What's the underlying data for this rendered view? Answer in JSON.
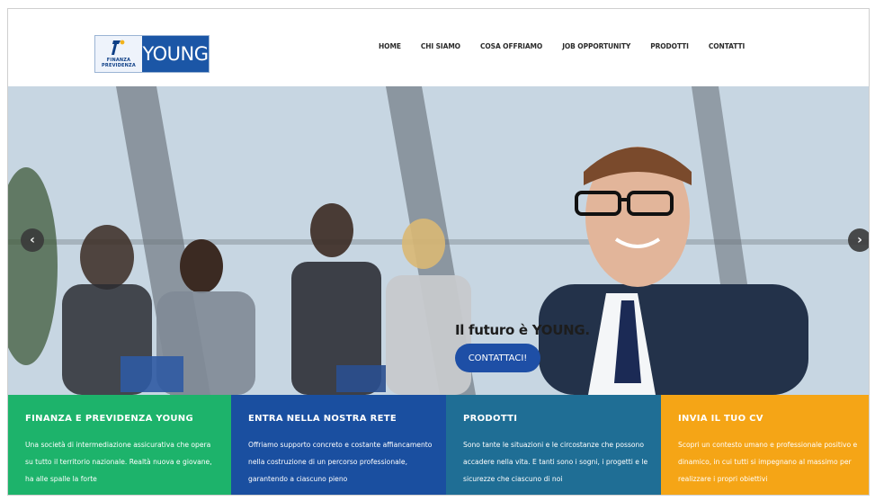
{
  "header": {
    "logo": {
      "left_line1": "FINANZA",
      "left_line2": "PREVIDENZA",
      "right_text": "YOUNG"
    },
    "nav": [
      {
        "label": "HOME"
      },
      {
        "label": "CHI SIAMO"
      },
      {
        "label": "COSA OFFRIAMO"
      },
      {
        "label": "JOB OPPORTUNITY"
      },
      {
        "label": "PRODOTTI"
      },
      {
        "label": "CONTATTI"
      }
    ]
  },
  "hero": {
    "title": "Il futuro è YOUNG.",
    "cta_label": "CONTATTACI!",
    "arrow_left": "‹",
    "arrow_right": "›"
  },
  "panels": [
    {
      "title": "FINANZA E PREVIDENZA YOUNG",
      "text": "Una società di intermediazione assicurativa che opera su tutto il territorio nazionale. Realtà nuova e giovane, ha alle spalle la forte",
      "color": "#1db36b"
    },
    {
      "title": "ENTRA NELLA NOSTRA RETE",
      "text": "Offriamo supporto concreto e costante affiancamento nella costruzione di un percorso professionale, garantendo a ciascuno pieno",
      "color": "#1a4fa0"
    },
    {
      "title": "PRODOTTI",
      "text": "Sono tante le situazioni e le circostanze che possono accadere nella vita. E tanti sono i sogni, i progetti e le sicurezze che ciascuno di noi",
      "color": "#1f6e95"
    },
    {
      "title": "INVIA IL TUO CV",
      "text": "Scopri un contesto umano e professionale positivo e dinamico, in cui tutti si impegnano al massimo per realizzare i propri obiettivi",
      "color": "#f5a516"
    }
  ]
}
